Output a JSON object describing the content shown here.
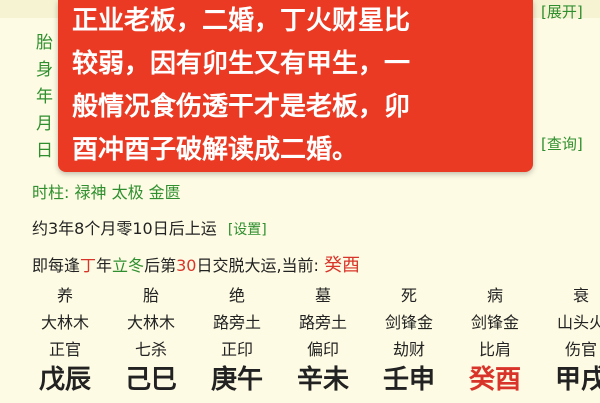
{
  "top_links": {
    "expand": "[展开]",
    "query": "[查询]"
  },
  "left_labels": [
    "胎",
    "身",
    "年",
    "月",
    "日"
  ],
  "overlay": {
    "lines": [
      "正业老板，二婚，丁火财星比",
      "较弱，因有卯生又有甲生，一",
      "般情况食伤透干才是老板，卯",
      "酉冲酉子破解读成二婚。"
    ]
  },
  "hour_pillar": {
    "label": "时柱:",
    "tags": "禄神 太极 金匮"
  },
  "start_luck": {
    "text": "约3年8个月零10日后上运",
    "settings": "[设置]"
  },
  "transition": {
    "prefix": "即每逢",
    "stem": "丁",
    "mid1": "年",
    "term": "立冬",
    "mid2": "后第",
    "day": "30",
    "suffix": "日交脱大运,当前:",
    "current": "癸酉"
  },
  "columns": [
    {
      "stage": "养",
      "nayin": "大林木",
      "god": "正官",
      "pillar": "戊辰"
    },
    {
      "stage": "胎",
      "nayin": "大林木",
      "god": "七杀",
      "pillar": "己巳"
    },
    {
      "stage": "绝",
      "nayin": "路旁土",
      "god": "正印",
      "pillar": "庚午"
    },
    {
      "stage": "墓",
      "nayin": "路旁土",
      "god": "偏印",
      "pillar": "辛未"
    },
    {
      "stage": "死",
      "nayin": "剑锋金",
      "god": "劫财",
      "pillar": "壬申"
    },
    {
      "stage": "病",
      "nayin": "剑锋金",
      "god": "比肩",
      "pillar": "癸酉",
      "current": true
    },
    {
      "stage": "衰",
      "nayin": "山头火",
      "god": "伤官",
      "pillar": "甲戌"
    }
  ],
  "colors": {
    "green": "#2f8f2f",
    "red": "#d9342a",
    "overlay": "#ea3a23",
    "background": "#fdfbe3"
  }
}
